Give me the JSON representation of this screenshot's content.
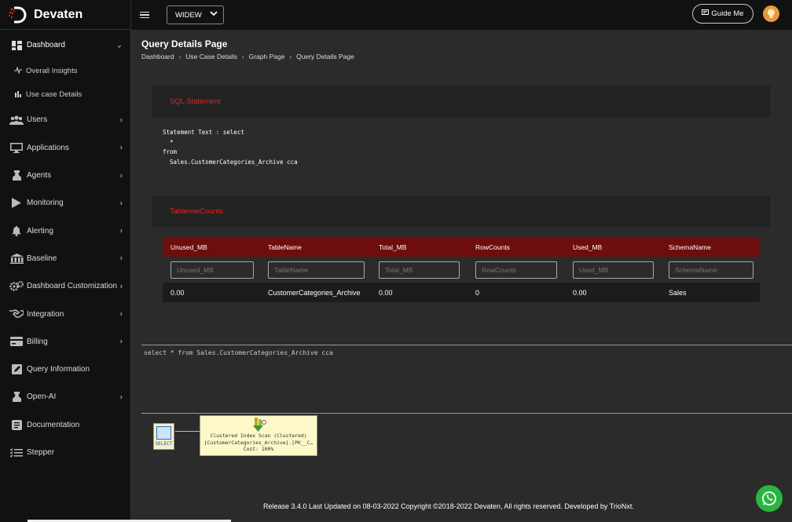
{
  "app": {
    "brand": "Devaten"
  },
  "topbar": {
    "environment": "WIDEW",
    "guide_label": "Guide Me"
  },
  "sidebar": {
    "items": [
      {
        "label": "Dashboard",
        "icon": "dashboard-icon",
        "expanded": true
      },
      {
        "label": "Overall Insights",
        "icon": "pulse-icon",
        "sub": true
      },
      {
        "label": "Use case Details",
        "icon": "bar-chart-icon",
        "sub": true
      },
      {
        "label": "Users",
        "icon": "users-icon"
      },
      {
        "label": "Applications",
        "icon": "monitor-icon"
      },
      {
        "label": "Agents",
        "icon": "agent-icon"
      },
      {
        "label": "Monitoring",
        "icon": "play-icon"
      },
      {
        "label": "Alerting",
        "icon": "bell-icon"
      },
      {
        "label": "Baseline",
        "icon": "bank-icon"
      },
      {
        "label": "Dashboard Customization",
        "icon": "gears-icon"
      },
      {
        "label": "Integration",
        "icon": "handshake-icon"
      },
      {
        "label": "Billing",
        "icon": "credit-card-icon"
      },
      {
        "label": "Query Information",
        "icon": "edit-icon"
      },
      {
        "label": "Open-AI",
        "icon": "robot-icon"
      },
      {
        "label": "Documentation",
        "icon": "document-icon"
      },
      {
        "label": "Stepper",
        "icon": "list-icon"
      }
    ]
  },
  "page": {
    "title": "Query Details Page",
    "breadcrumbs": [
      "Dashboard",
      "Use Case Details",
      "Graph Page",
      "Query Details Page"
    ]
  },
  "sql_panel": {
    "title": "SQL Statement",
    "statement": "Statement Text : select\n  *\nfrom\n  Sales.CustomerCategories_Archive cca"
  },
  "rowcount_panel": {
    "title": "TablerowCounts",
    "columns": [
      "Unused_MB",
      "TableName",
      "Total_MB",
      "RowCounts",
      "Used_MB",
      "SchemaName"
    ],
    "filter_placeholders": [
      "Unused_MB",
      "TableName",
      "Total_MB",
      "RowCounts",
      "Used_MB",
      "SchemaName"
    ],
    "rows": [
      [
        "0.00",
        "CustomerCategories_Archive",
        "0.00",
        "0",
        "0.00",
        "Sales"
      ]
    ]
  },
  "query": {
    "text": "select * from Sales.CustomerCategories_Archive cca"
  },
  "plan": {
    "select_label": "SELECT",
    "scan_line1": "Clustered Index Scan (Clustered)",
    "scan_line2": "[CustomerCategories_Archive].[PK__C…",
    "scan_line3": "Cost: 100%"
  },
  "footer": {
    "text": "Release 3.4.0 Last Updated on 08-03-2022 Copyright ©2018-2022 Devaten, All rights reserved. Developed by TrioNxt."
  },
  "colors": {
    "accent_red": "#e02424",
    "table_header": "#6e0d0d",
    "whatsapp": "#2ab540",
    "bulb": "#e89a3a"
  }
}
